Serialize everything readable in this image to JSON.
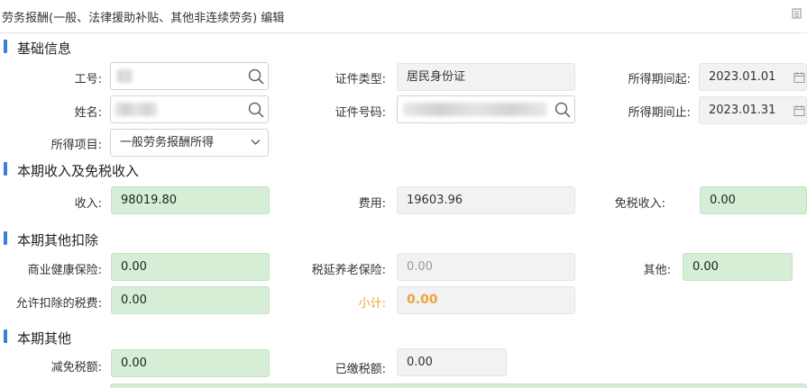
{
  "window": {
    "title": "劳务报酬(一般、法律援助补贴、其他非连续劳务) 编辑",
    "icon": "window-restore-icon"
  },
  "sections": {
    "basic": "基础信息",
    "income": "本期收入及免税收入",
    "deduction": "本期其他扣除",
    "other": "本期其他"
  },
  "basic": {
    "employee_id_label": "工号:",
    "name_label": "姓名:",
    "income_item_label": "所得项目:",
    "income_item_value": "一般劳务报酬所得",
    "id_type_label": "证件类型:",
    "id_type_value": "居民身份证",
    "id_number_label": "证件号码:",
    "period_start_label": "所得期间起:",
    "period_start_value": "2023.01.01",
    "period_end_label": "所得期间止:",
    "period_end_value": "2023.01.31"
  },
  "income": {
    "income_label": "收入:",
    "income_value": "98019.80",
    "expense_label": "费用:",
    "expense_value": "19603.96",
    "taxfree_label": "免税收入:",
    "taxfree_value": "0.00"
  },
  "deduction": {
    "health_label": "商业健康保险:",
    "health_value": "0.00",
    "pension_label": "税延养老保险:",
    "pension_value": "0.00",
    "other_label": "其他:",
    "other_value": "0.00",
    "taxfee_label": "允许扣除的税费:",
    "taxfee_value": "0.00",
    "subtotal_label": "小计:",
    "subtotal_value": "0.00"
  },
  "other": {
    "reduction_label": "减免税额:",
    "reduction_value": "0.00",
    "paid_label": "已缴税额:",
    "paid_value": "0.00"
  }
}
